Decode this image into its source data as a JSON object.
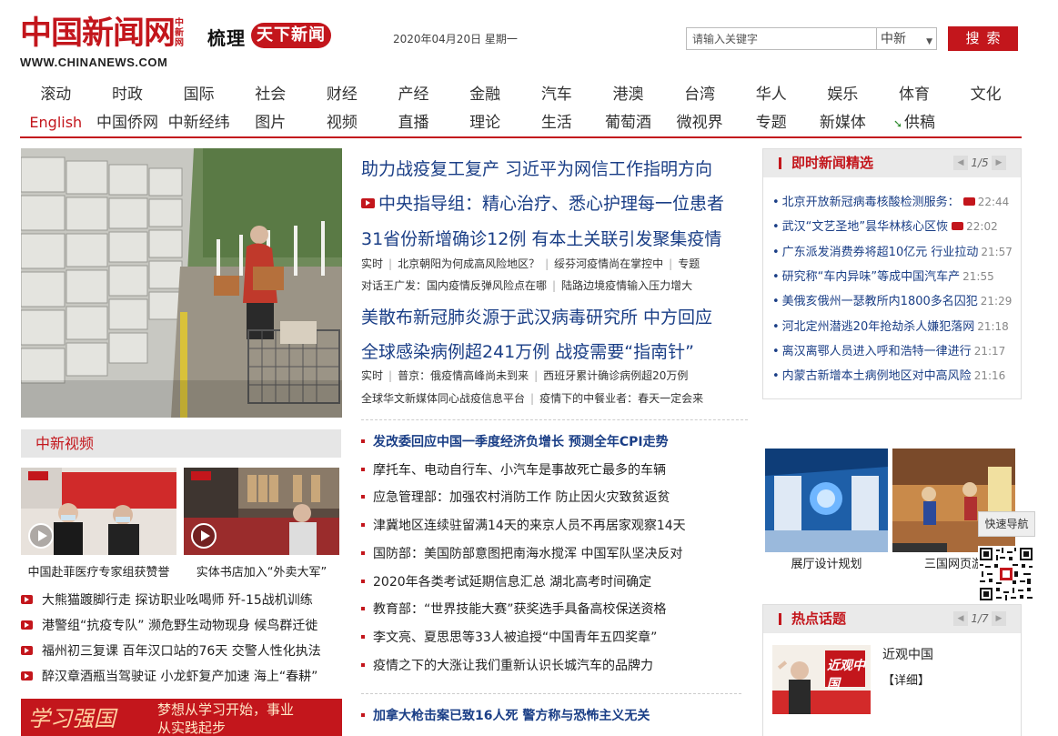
{
  "header": {
    "logo_text": "中国新闻网",
    "logo_vertical": "中新网",
    "logo_url": "WWW.CHINANEWS.COM",
    "slogan_part1": "梳理",
    "slogan_part2": "天下新闻",
    "date": "2020年04月20日 星期一",
    "search_placeholder": "请输入关键字",
    "search_scope": "中新",
    "search_button": "搜索"
  },
  "nav": {
    "row1": [
      "滚动",
      "时政",
      "国际",
      "社会",
      "财经",
      "产经",
      "金融",
      "汽车",
      "港澳",
      "台湾",
      "华人",
      "娱乐",
      "体育",
      "文化"
    ],
    "row2": [
      "English",
      "中国侨网",
      "中新经纬",
      "图片",
      "视频",
      "直播",
      "理论",
      "生活",
      "葡萄酒",
      "微视界",
      "专题",
      "新媒体",
      "供稿"
    ]
  },
  "headlines": {
    "h1": "助力战疫复工复产 习近平为网信工作指明方向",
    "h2": "中央指导组：精心治疗、悉心护理每一位患者",
    "h3": "31省份新增确诊12例 有本土关联引发聚集疫情",
    "sub1": [
      "实时",
      "北京朝阳为何成高风险地区？",
      "绥芬河疫情尚在掌控中",
      "专题"
    ],
    "sub2": [
      "对话王广发：国内疫情反弹风险点在哪",
      "陆路边境疫情输入压力增大"
    ],
    "h4": "美散布新冠肺炎源于武汉病毒研究所 中方回应",
    "h5": "全球感染病例超241万例 战疫需要“指南针”",
    "sub3": [
      "实时",
      "普京：俄疫情高峰尚未到来",
      "西班牙累计确诊病例超20万例"
    ],
    "sub4": [
      "全球华文新媒体同心战疫信息平台",
      "疫情下的中餐业者：春天一定会来"
    ]
  },
  "news_list": [
    "发改委回应中国一季度经济负增长  预测全年CPI走势",
    "摩托车、电动自行车、小汽车是事故死亡最多的车辆",
    "应急管理部：加强农村消防工作 防止因火灾致贫返贫",
    "津冀地区连续驻留满14天的来京人员不再居家观察14天",
    "国防部：美国防部意图把南海水搅浑 中国军队坚决反对",
    "2020年各类考试延期信息汇总 湖北高考时间确定",
    "教育部：“世界技能大赛”获奖选手具备高校保送资格",
    "李文亮、夏思思等33人被追授“中国青年五四奖章”",
    "疫情之下的大涨让我们重新认识长城汽车的品牌力"
  ],
  "news_list_2": [
    "加拿大枪击案已致16人死  警方称与恐怖主义无关"
  ],
  "video": {
    "section_title": "中新视频",
    "thumb1_caption": "中国赴菲医疗专家组获赞誉",
    "thumb2_caption": "实体书店加入“外卖大军”",
    "list": [
      "大熊猫踱脚行走 探访职业吆喝师 歼-15战机训练",
      "港警组“抗疫专队” 濒危野生动物现身 候鸟群迁徙",
      "福州初三复课 百年汉口站的76天 交警人性化执法",
      "醉汉章酒瓶当驾驶证 小龙虾复产加速 海上“春耕”"
    ],
    "banner_text": "梦想从学习开始，事业从实践起步",
    "banner_logo": "学习强国"
  },
  "instant": {
    "title": "即时新闻精选",
    "pager": "1/5",
    "items": [
      {
        "text": "北京开放新冠病毒核酸检测服务：",
        "time": "22:44",
        "video": true
      },
      {
        "text": "武汉“文艺圣地”昙华林核心区恢",
        "time": "22:02",
        "video": true
      },
      {
        "text": "广东派发消费券将超10亿元 行业拉动",
        "time": "21:57",
        "video": false
      },
      {
        "text": "研究称“车内异味”等成中国汽车产",
        "time": "21:55",
        "video": false
      },
      {
        "text": "美俄亥俄州一瑟教所内1800多名囚犯",
        "time": "21:29",
        "video": false
      },
      {
        "text": "河北定州潜逃20年抢劫杀人嫌犯落网",
        "time": "21:18",
        "video": false
      },
      {
        "text": "离汉离鄂人员进入呼和浩特一律进行",
        "time": "21:17",
        "video": false
      },
      {
        "text": "内蒙古新增本土病例地区对中高风险",
        "time": "21:16",
        "video": false
      }
    ]
  },
  "right_images": {
    "cap1": "展厅设计规划",
    "cap2": "三国网页游"
  },
  "float_nav": "快速导航",
  "topics": {
    "title": "热点话题",
    "pager": "1/7",
    "item_title": "近观中国",
    "item_detail": "【详细】",
    "img_text": "近观中国"
  }
}
